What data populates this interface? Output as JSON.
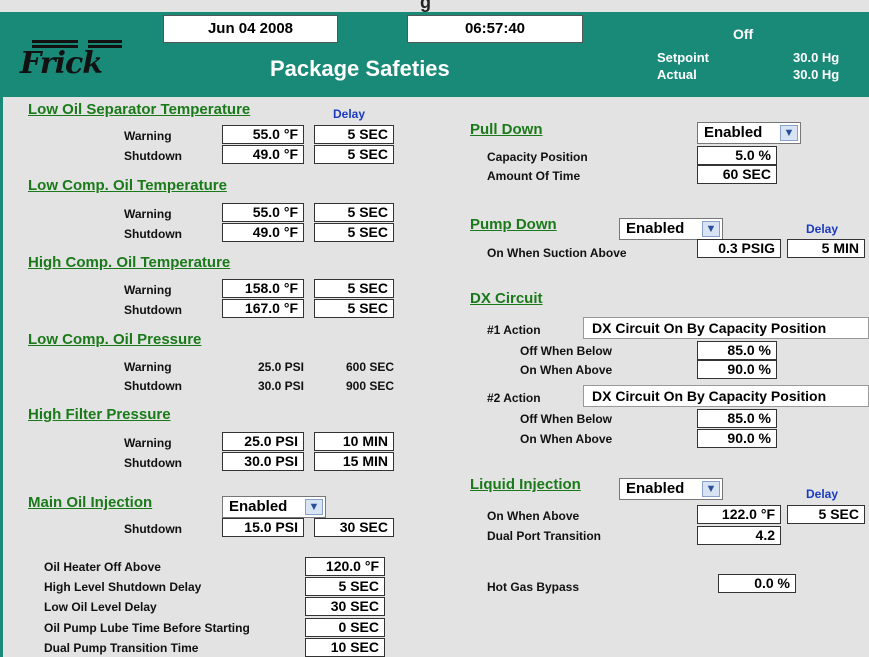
{
  "top_cut": "g",
  "header": {
    "logo_text": "Frick",
    "date": "Jun 04 2008",
    "time": "06:57:40",
    "title": "Package Safeties",
    "status": "Off",
    "setpoint_label": "Setpoint",
    "setpoint_value": "30.0 Hg",
    "actual_label": "Actual",
    "actual_value": "30.0 Hg"
  },
  "delay_label": "Delay",
  "left": {
    "low_oil_sep": {
      "title": "Low Oil Separator Temperature",
      "warning_label": "Warning",
      "warning_value": "55.0 °F",
      "warning_delay": "5 SEC",
      "shutdown_label": "Shutdown",
      "shutdown_value": "49.0 °F",
      "shutdown_delay": "5 SEC"
    },
    "low_comp_oil_temp": {
      "title": "Low Comp. Oil Temperature",
      "warning_label": "Warning",
      "warning_value": "55.0 °F",
      "warning_delay": "5 SEC",
      "shutdown_label": "Shutdown",
      "shutdown_value": "49.0 °F",
      "shutdown_delay": "5 SEC"
    },
    "high_comp_oil_temp": {
      "title": "High Comp. Oil Temperature",
      "warning_label": "Warning",
      "warning_value": "158.0 °F",
      "warning_delay": "5 SEC",
      "shutdown_label": "Shutdown",
      "shutdown_value": "167.0 °F",
      "shutdown_delay": "5 SEC"
    },
    "low_comp_oil_press": {
      "title": "Low Comp. Oil Pressure",
      "warning_label": "Warning",
      "warning_value": "25.0 PSI",
      "warning_delay": "600 SEC",
      "shutdown_label": "Shutdown",
      "shutdown_value": "30.0 PSI",
      "shutdown_delay": "900 SEC"
    },
    "high_filter_press": {
      "title": "High Filter Pressure",
      "warning_label": "Warning",
      "warning_value": "25.0 PSI",
      "warning_delay": "10 MIN",
      "shutdown_label": "Shutdown",
      "shutdown_value": "30.0 PSI",
      "shutdown_delay": "15 MIN"
    },
    "main_oil_injection": {
      "title": "Main Oil Injection",
      "select": "Enabled",
      "shutdown_label": "Shutdown",
      "shutdown_value": "15.0 PSI",
      "shutdown_delay": "30 SEC"
    },
    "misc": [
      {
        "label": "Oil Heater Off Above",
        "value": "120.0 °F"
      },
      {
        "label": "High Level Shutdown Delay",
        "value": "5 SEC"
      },
      {
        "label": "Low Oil Level Delay",
        "value": "30 SEC"
      },
      {
        "label": "Oil Pump Lube Time Before Starting",
        "value": "0 SEC"
      },
      {
        "label": "Dual Pump Transition Time",
        "value": "10 SEC"
      }
    ]
  },
  "right": {
    "pull_down": {
      "title": "Pull Down",
      "select": "Enabled",
      "capacity_label": "Capacity Position",
      "capacity_value": "5.0 %",
      "time_label": "Amount Of Time",
      "time_value": "60 SEC"
    },
    "pump_down": {
      "title": "Pump Down",
      "select": "Enabled",
      "suction_label": "On When Suction Above",
      "suction_value": "0.3 PSIG",
      "suction_delay": "5 MIN"
    },
    "dx_circuit": {
      "title": "DX Circuit",
      "a1_label": "#1 Action",
      "a1_value": "DX Circuit On By Capacity Position",
      "a1_off_label": "Off When Below",
      "a1_off_value": "85.0 %",
      "a1_on_label": "On When Above",
      "a1_on_value": "90.0 %",
      "a2_label": "#2 Action",
      "a2_value": "DX Circuit On By Capacity Position",
      "a2_off_label": "Off When Below",
      "a2_off_value": "85.0 %",
      "a2_on_label": "On When Above",
      "a2_on_value": "90.0 %"
    },
    "liquid_injection": {
      "title": "Liquid Injection",
      "select": "Enabled",
      "on_label": "On When Above",
      "on_value": "122.0 °F",
      "on_delay": "5 SEC",
      "dual_label": "Dual Port Transition",
      "dual_value": "4.2"
    },
    "hot_gas": {
      "label": "Hot Gas Bypass",
      "value": "0.0 %"
    }
  }
}
